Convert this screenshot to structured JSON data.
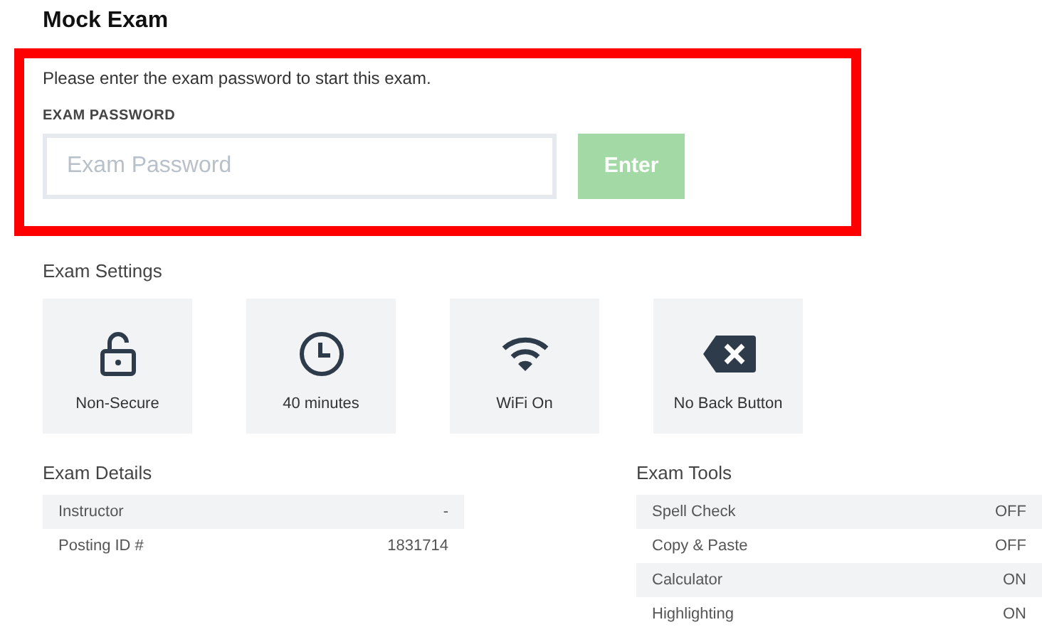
{
  "title": "Mock Exam",
  "password_prompt": {
    "message": "Please enter the exam password to start this exam.",
    "label": "EXAM PASSWORD",
    "placeholder": "Exam Password",
    "button": "Enter",
    "button_disabled": true
  },
  "exam_settings": {
    "heading": "Exam Settings",
    "items": [
      {
        "kind": "lock",
        "label": "Non-Secure"
      },
      {
        "kind": "clock",
        "label": "40 minutes"
      },
      {
        "kind": "wifi",
        "label": "WiFi On"
      },
      {
        "kind": "backspace",
        "label": "No Back Button"
      }
    ]
  },
  "exam_details": {
    "heading": "Exam Details",
    "rows": [
      {
        "label": "Instructor",
        "value": "-"
      },
      {
        "label": "Posting ID #",
        "value": "1831714"
      }
    ]
  },
  "exam_tools": {
    "heading": "Exam Tools",
    "rows": [
      {
        "label": "Spell Check",
        "value": "OFF"
      },
      {
        "label": "Copy & Paste",
        "value": "OFF"
      },
      {
        "label": "Calculator",
        "value": "ON"
      },
      {
        "label": "Highlighting",
        "value": "ON"
      }
    ]
  }
}
